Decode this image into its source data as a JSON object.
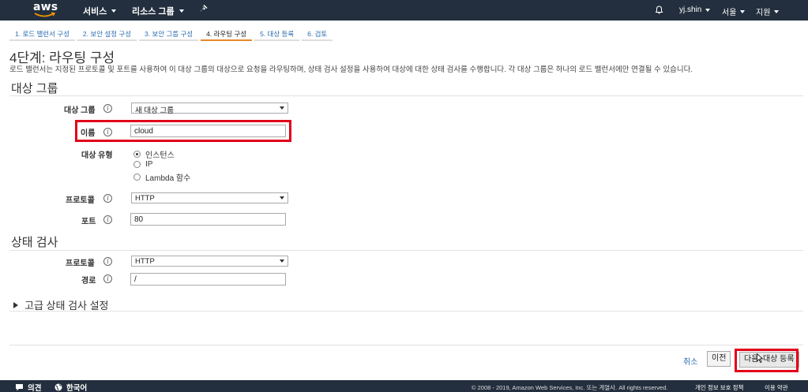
{
  "topnav": {
    "logo": "aws",
    "services": "서비스",
    "resource_groups": "리소스 그룹",
    "user": "yj.shin",
    "region": "서울",
    "support": "지원"
  },
  "steps": [
    "1. 로드 밸런서 구성",
    "2. 보안 설정 구성",
    "3. 보안 그룹 구성",
    "4. 라우팅 구성",
    "5. 대상 등록",
    "6. 검토"
  ],
  "page": {
    "title": "4단계: 라우팅 구성",
    "description": "로드 밸런서는 지정된 프로토콜 및 포트를 사용하여 이 대상 그룹의 대상으로 요청을 라우팅하며, 상태 검사 설정을 사용하여 대상에 대한 상태 검사를 수행합니다. 각 대상 그룹은 하나의 로드 밸런서에만 연결될 수 있습니다."
  },
  "target_group": {
    "section_title": "대상 그룹",
    "target_group_label": "대상 그룹",
    "target_group_value": "새 대상 그룹",
    "name_label": "이름",
    "name_value": "cloud",
    "target_type_label": "대상 유형",
    "target_type_options": [
      "인스턴스",
      "IP",
      "Lambda 함수"
    ],
    "protocol_label": "프로토콜",
    "protocol_value": "HTTP",
    "port_label": "포트",
    "port_value": "80"
  },
  "health_check": {
    "section_title": "상태 검사",
    "protocol_label": "프로토콜",
    "protocol_value": "HTTP",
    "path_label": "경로",
    "path_value": "/",
    "advanced_label": "고급 상태 검사 설정"
  },
  "footer": {
    "cancel": "취소",
    "previous": "이전",
    "next": "다음: 대상 등록"
  },
  "bottombar": {
    "feedback": "의견",
    "language": "한국어",
    "copyright": "© 2008 - 2019, Amazon Web Services, Inc. 또는 계열사. All rights reserved.",
    "privacy": "개인 정보 보호 정책",
    "terms": "이용 약관"
  },
  "colors": {
    "nav_bg": "#232f3e",
    "active_step": "#e7882a",
    "link": "#2a6cb0",
    "highlight": "#e2001a"
  }
}
